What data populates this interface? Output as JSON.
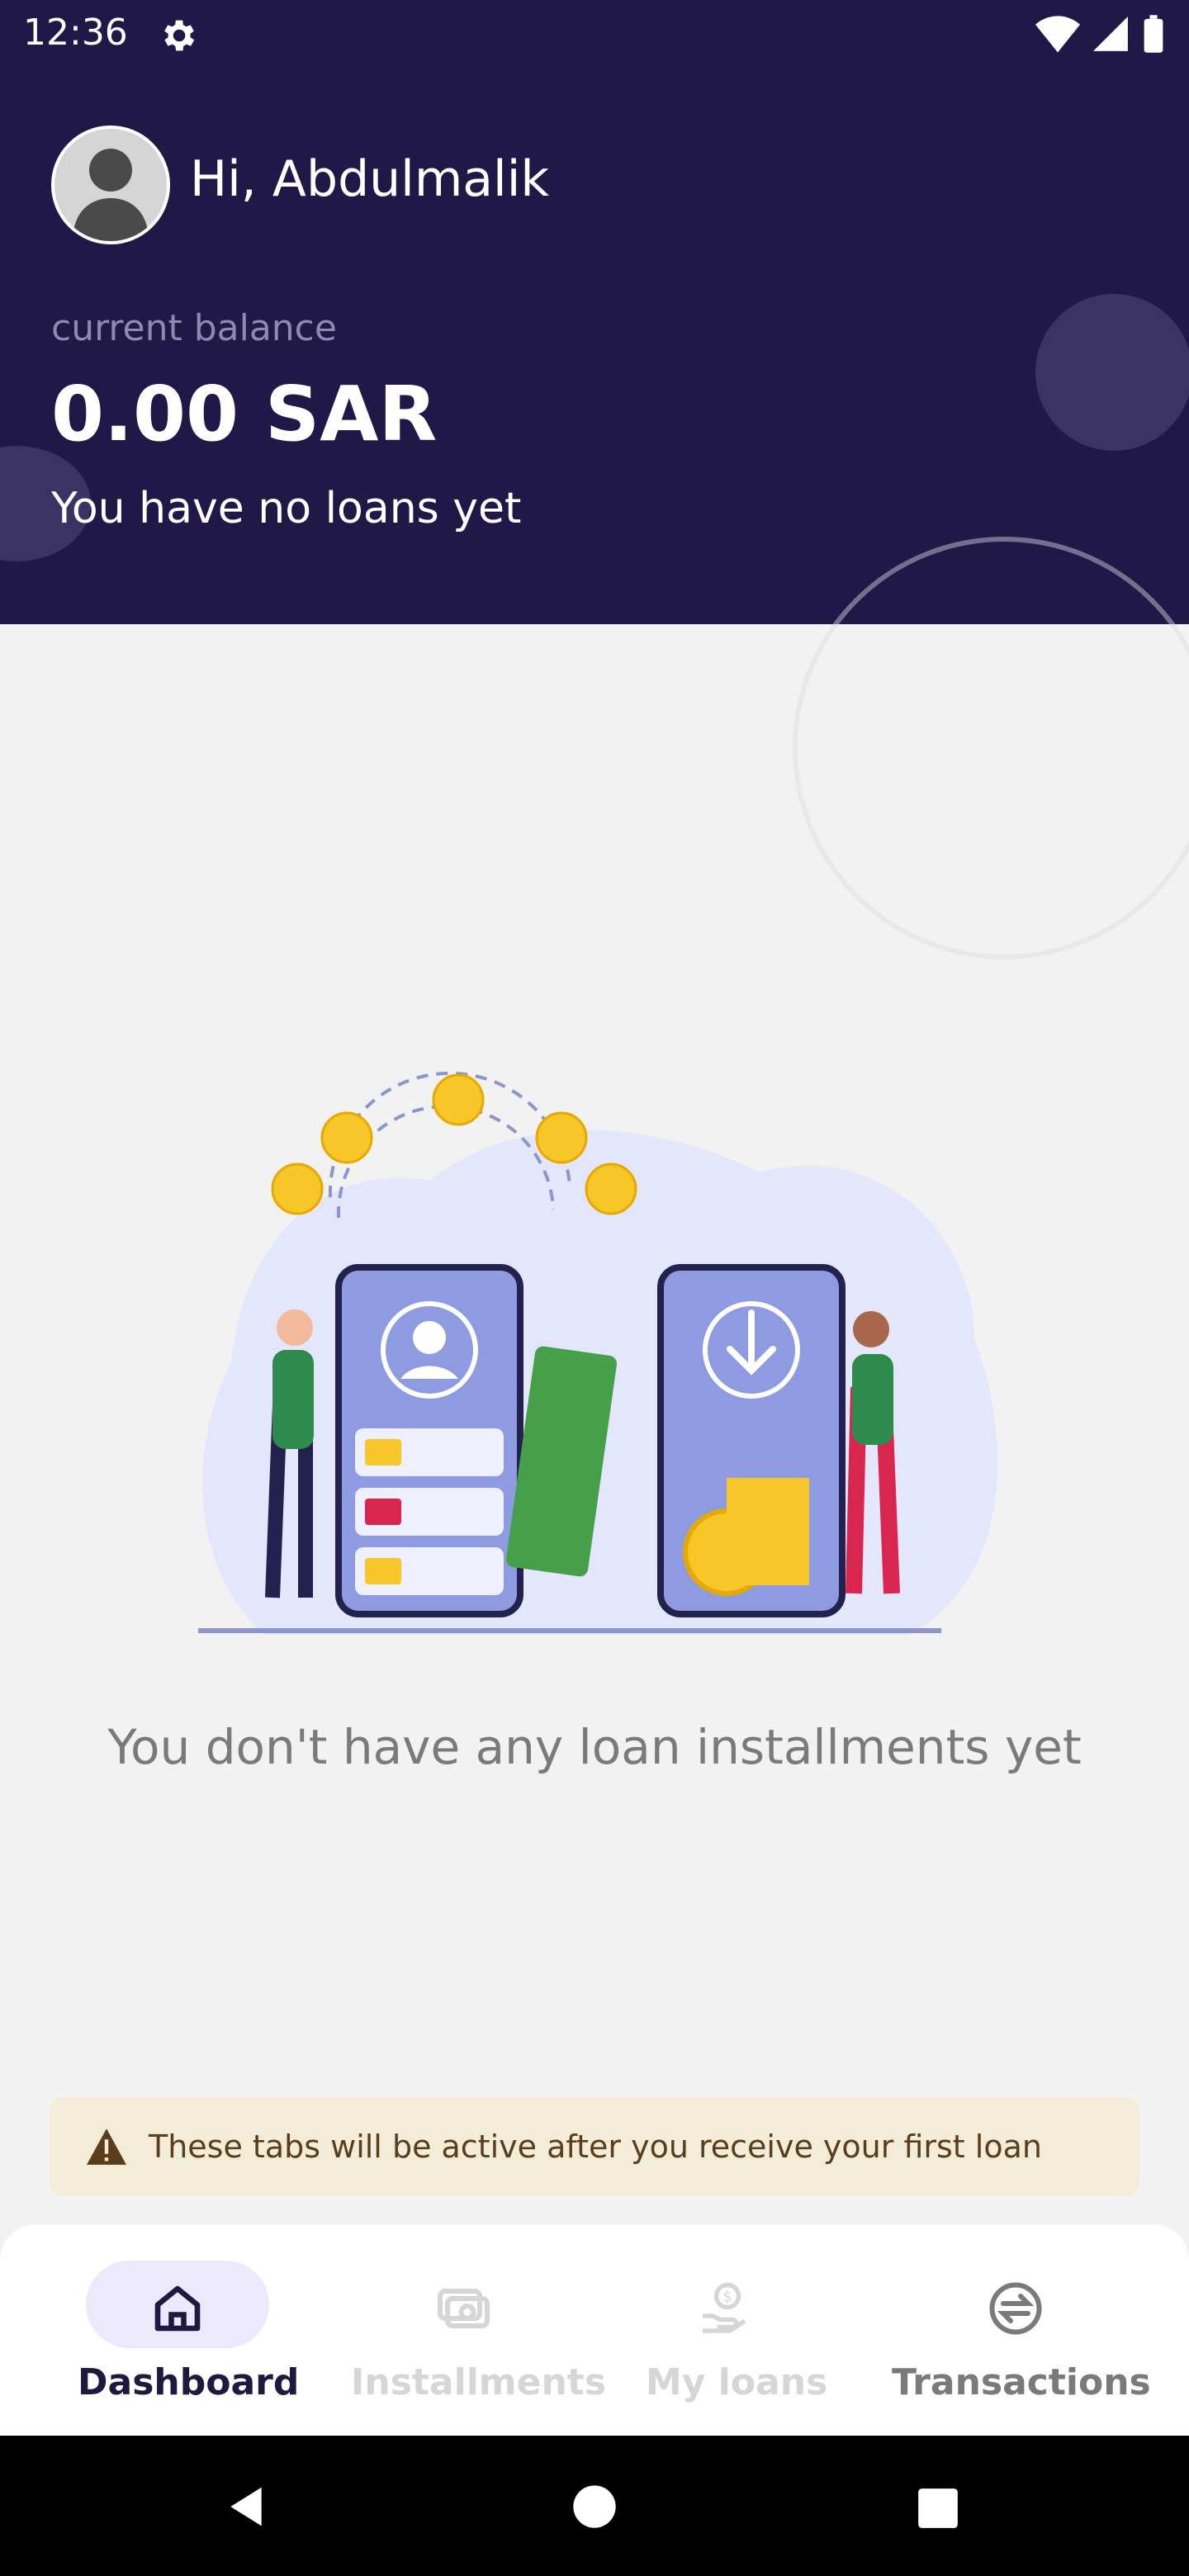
{
  "status_bar": {
    "time": "12:36"
  },
  "header": {
    "greeting": "Hi, Abdulmalik",
    "balance_label": "current balance",
    "balance": "0.00 SAR",
    "loans_status": "You have no loans yet"
  },
  "main": {
    "empty_message": "You don't have any loan installments yet"
  },
  "notice": {
    "text": "These tabs will be active after you receive your first loan"
  },
  "bottom_nav": {
    "items": [
      {
        "label": "Dashboard",
        "icon": "home-icon",
        "active": true
      },
      {
        "label": "Installments",
        "icon": "installments-icon",
        "active": false
      },
      {
        "label": "My loans",
        "icon": "loan-hand-icon",
        "active": false
      },
      {
        "label": "Transactions",
        "icon": "transactions-icon",
        "active": false
      }
    ]
  },
  "colors": {
    "header_bg": "#201847",
    "active_nav": "#1d1a3f",
    "disabled_nav": "#d6d6d6",
    "enabled_nav": "#7a7a7a",
    "notice_bg": "#f3ecd9"
  }
}
